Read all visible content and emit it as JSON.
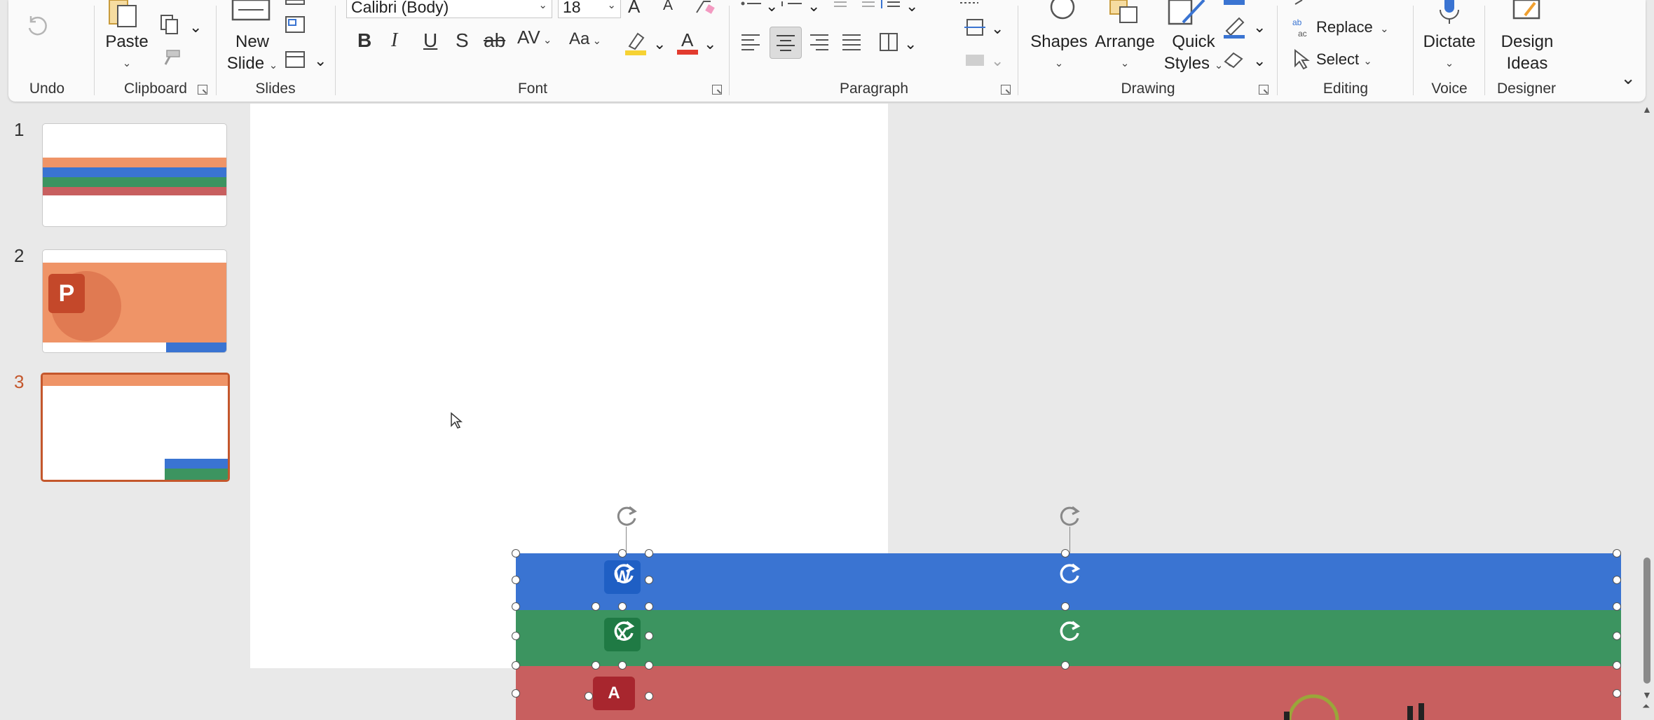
{
  "ribbon": {
    "undo": {
      "label": "Undo"
    },
    "clipboard": {
      "label": "Clipboard",
      "paste": "Paste"
    },
    "slides": {
      "label": "Slides",
      "new_slide_line1": "New",
      "new_slide_line2": "Slide"
    },
    "font": {
      "label": "Font",
      "family": "Calibri (Body)",
      "size": "18",
      "bold": "B",
      "italic": "I",
      "underline": "U",
      "shadow": "S",
      "strike": "ab",
      "spacing": "AV",
      "case": "Aa",
      "grow": "A",
      "shrink": "A",
      "highlight_color": "#f6d233",
      "font_color": "#e23b2e"
    },
    "paragraph": {
      "label": "Paragraph"
    },
    "drawing": {
      "label": "Drawing",
      "shapes": "Shapes",
      "arrange": "Arrange",
      "quick_styles_line1": "Quick",
      "quick_styles_line2": "Styles",
      "replace": "Replace",
      "select": "Select"
    },
    "editing": {
      "label": "Editing",
      "replace": "Replace",
      "select": "Select"
    },
    "voice": {
      "label": "Voice",
      "dictate": "Dictate"
    },
    "designer": {
      "label": "Designer",
      "design_line1": "Design",
      "design_line2": "Ideas"
    }
  },
  "slides_pane": {
    "items": [
      {
        "number": "1"
      },
      {
        "number": "2",
        "logo_letter": "P"
      },
      {
        "number": "3"
      }
    ],
    "selected": "3"
  },
  "canvas": {
    "band_colors": {
      "word": "#3a74d2",
      "excel": "#3c9460",
      "access": "#c85f5f",
      "orange": "#ef9467"
    },
    "icon_letters": {
      "word": "W",
      "excel": "X",
      "access": "A"
    }
  }
}
